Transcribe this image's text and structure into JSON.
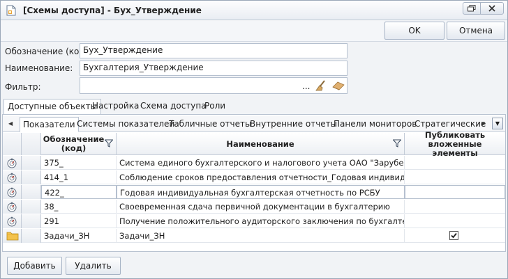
{
  "window": {
    "title": "[Схемы доступа] - Бух_Утверждение"
  },
  "toolbar": {
    "ok_label": "OK",
    "cancel_label": "Отмена"
  },
  "form": {
    "code_label": "Обозначение (код):",
    "code_value": "Бух_Утверждение",
    "name_label": "Наименование:",
    "name_value": "Бухгалтерия_Утверждение",
    "filter_label": "Фильтр:",
    "filter_value": "...",
    "ellipsis": "..."
  },
  "main_tabs": [
    {
      "label": "Доступные объекты",
      "active": true
    },
    {
      "label": "Настройка",
      "active": false
    },
    {
      "label": "Схема доступа",
      "active": false
    },
    {
      "label": "Роли",
      "active": false
    }
  ],
  "sub_tabs": [
    {
      "label": "Показатели",
      "active": true
    },
    {
      "label": "Системы показателей",
      "active": false
    },
    {
      "label": "Табличные отчеты",
      "active": false
    },
    {
      "label": "Внутренние отчеты",
      "active": false
    },
    {
      "label": "Панели мониторов",
      "active": false
    },
    {
      "label": "Стратегические",
      "active": false
    }
  ],
  "grid": {
    "columns": {
      "code": "Обозначение\n(код)",
      "name": "Наименование",
      "publish": "Публиковать\nвложенные элементы"
    },
    "rows": [
      {
        "icon": "indicator-icon",
        "code": "375_",
        "name": "Система единого бухгалтерского и налогового учета ОАО \"Зарубежнефть\"",
        "publish": null
      },
      {
        "icon": "indicator-icon",
        "code": "414_1",
        "name": "Соблюдение сроков предоставления отчетности_Годовая индивидуальная",
        "publish": null
      },
      {
        "icon": "indicator-icon",
        "code": "422_",
        "name": "Годовая индивидуальная бухгалтерская отчетность по РСБУ",
        "publish": null
      },
      {
        "icon": "indicator-icon",
        "code": "38_",
        "name": "Своевременная сдача первичной документации в бухгалтерию",
        "publish": null
      },
      {
        "icon": "indicator-icon",
        "code": "291",
        "name": "Получение положительного аудиторского заключения по бухгалтерской",
        "publish": null
      },
      {
        "icon": "folder-icon",
        "code": "Задачи_ЗН",
        "name": "Задачи_ЗН",
        "publish": true
      }
    ]
  },
  "bottom": {
    "add_label": "Добавить",
    "delete_label": "Удалить"
  },
  "colors": {
    "border": "#b9c3d1",
    "folder": "#f3c24d",
    "broom": "#c49a5c"
  }
}
